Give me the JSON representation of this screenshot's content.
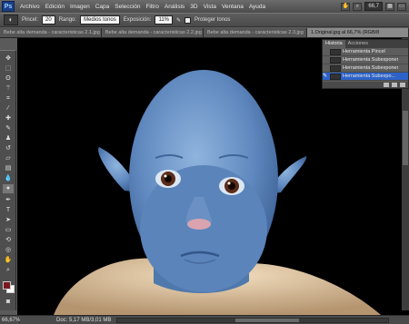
{
  "app": {
    "logo": "Ps"
  },
  "menu": [
    "Archivo",
    "Edición",
    "Imagen",
    "Capa",
    "Selección",
    "Filtro",
    "Análisis",
    "3D",
    "Vista",
    "Ventana",
    "Ayuda"
  ],
  "menubar_right": {
    "zoom": "66,7"
  },
  "options": {
    "tool_label": "Pincel:",
    "brush_size": "20",
    "rango_label": "Rango:",
    "rango_value": "Medios tonos",
    "exposicion_label": "Exposición:",
    "exposicion_value": "11%",
    "proteger_label": "Proteger tonos"
  },
  "tabs": [
    "Bebe alta demanda - caracteristicas 2.1.jpg",
    "Bebe alta demanda - caracteristicas 2.2.jpg",
    "Bebe alta demanda - caracteristicas 2.3.jpg",
    "1.Original.jpg al 66,7% (RGB/8"
  ],
  "history_panel": {
    "tabs": [
      "Historia",
      "Acciones"
    ],
    "items": [
      "Herramienta Pincel",
      "Herramienta Subexponer",
      "Herramienta Subexponer",
      "Herramienta Subexpo..."
    ],
    "active_index": 3
  },
  "status": {
    "zoom": "66,67%",
    "doc": "Doc: 5,17 MB/3,01 MB"
  },
  "colors": {
    "foreground": "#7a1a20",
    "background": "#ffffff",
    "selection": "#2d63c8"
  }
}
